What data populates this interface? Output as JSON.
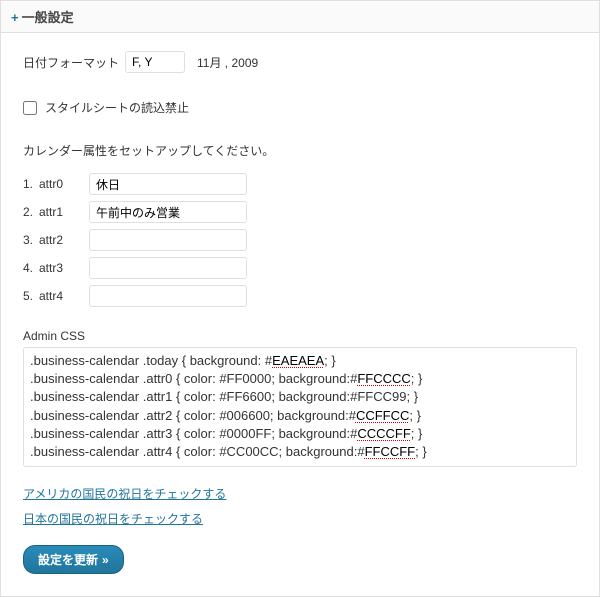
{
  "header": {
    "title": "一般設定"
  },
  "dateFormat": {
    "label": "日付フォーマット",
    "value": "F, Y",
    "sample": "11月 , 2009"
  },
  "stylesheet": {
    "label": "スタイルシートの読込禁止",
    "checked": false
  },
  "calendar": {
    "instruction": "カレンダー属性をセットアップしてください。",
    "attrs": [
      {
        "num": "1.",
        "name": "attr0",
        "value": "休日"
      },
      {
        "num": "2.",
        "name": "attr1",
        "value": "午前中のみ営業"
      },
      {
        "num": "3.",
        "name": "attr2",
        "value": ""
      },
      {
        "num": "4.",
        "name": "attr3",
        "value": ""
      },
      {
        "num": "5.",
        "name": "attr4",
        "value": ""
      }
    ]
  },
  "adminCss": {
    "label": "Admin CSS",
    "lines": [
      {
        "pre": ".business-calendar .today { background: #",
        "hl": "EAEAEA",
        "mid": "; }",
        "hl2": null,
        "post": ""
      },
      {
        "pre": ".business-calendar .attr0 { color: #FF0000; background:#",
        "hl": "FFCCCC",
        "mid": "; }",
        "hl2": null,
        "post": ""
      },
      {
        "pre": ".business-calendar .attr1 { color: #FF6600; background:#FFCC99; }",
        "hl": null,
        "mid": "",
        "hl2": null,
        "post": ""
      },
      {
        "pre": ".business-calendar .attr2 { color: #006600; background:#",
        "hl": "CCFFCC",
        "mid": "; }",
        "hl2": null,
        "post": ""
      },
      {
        "pre": ".business-calendar .attr3 { color: #0000FF; background:#",
        "hl": "CCCCFF",
        "mid": "; }",
        "hl2": null,
        "post": ""
      },
      {
        "pre": ".business-calendar .attr4 { color: #CC00CC; background:#",
        "hl": "FFCCFF",
        "mid": "; }",
        "hl2": null,
        "post": ""
      }
    ]
  },
  "links": {
    "usa": "アメリカの国民の祝日をチェックする",
    "japan": "日本の国民の祝日をチェックする"
  },
  "submit": {
    "label": "設定を更新"
  }
}
